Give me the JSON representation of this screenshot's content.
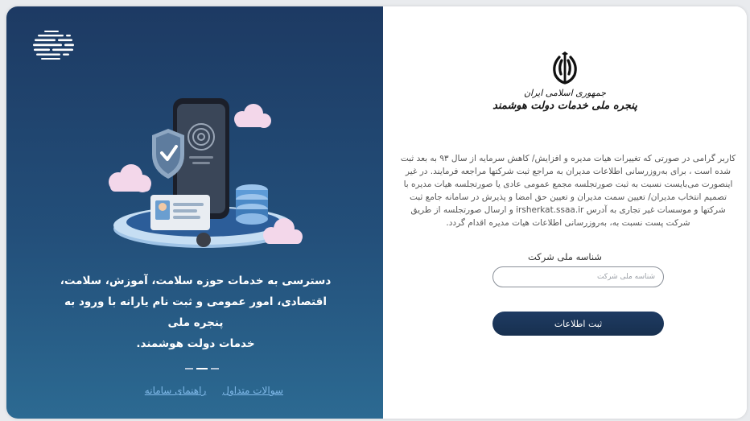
{
  "left_panel": {
    "headline_lines": [
      "دسترسی به خدمات حوزه سلامت، آموزش، سلامت،",
      "اقتصادی، امور عمومی و ثبت نام یارانه با ورود به پنجره ملی",
      "خدمات دولت هوشمند."
    ],
    "links": {
      "faq": "سوالات متداول",
      "guide": "راهنمای سامانه"
    },
    "icons": {
      "logo": "globe-icon",
      "illustration": "phone-fingerprint-illustration"
    }
  },
  "right_panel": {
    "emblem_line1": "جمهوری اسلامی ایران",
    "emblem_line2": "پنجره ملی خدمات دولت هوشمند",
    "notice_lines": [
      "کاربر گرامی در صورتی که تغییرات هیات مدیره و افزایش/ کاهش سرمایه از سال ۹۳ به بعد ثبت",
      "شده است ، برای به‌روزرسانی اطلاعات مدیران به مراجع ثبت شرکتها مراجعه فرمایند. در غیر",
      "اینصورت می‌بایست نسبت به ثبت صورتجلسه مجمع عمومی عادی یا صورتجلسه هیات مدیره با",
      "تصمیم انتخاب مدیران/ تعیین سمت مدیران و تعیین حق امضا و پذیرش در سامانه جامع ثبت",
      "شرکتها و موسسات غیر تجاری به آدرس irsherkat.ssaa.ir و ارسال صورتجلسه از طریق",
      "شرکت پست نسبت به، به‌روزرسانی اطلاعات هیات مدیره اقدام گردد."
    ],
    "field_label": "شناسه ملی شرکت",
    "field_placeholder": "شناسه ملی شرکت",
    "field_value": "",
    "submit_label": "ثبت اطلاعات"
  },
  "colors": {
    "panel_dark": "#1d3a63",
    "panel_light": "#2c6a92",
    "button": "#1f3b63",
    "link": "#7fb8e8"
  }
}
